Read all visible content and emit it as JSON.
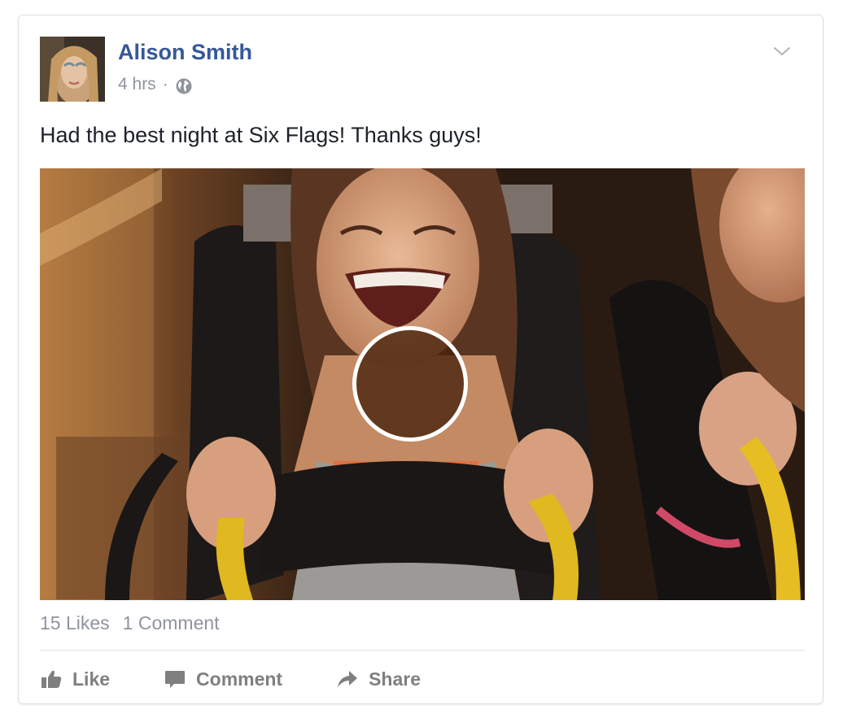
{
  "post": {
    "author": "Alison Smith",
    "timestamp": "4 hrs",
    "separator": "·",
    "audience_icon": "globe-icon",
    "menu_icon": "chevron-down-icon",
    "text": "Had the best night at Six Flags! Thanks guys!",
    "media": {
      "type": "video",
      "overlay_icon": "play-circle-icon"
    }
  },
  "stats": {
    "likes": "15 Likes",
    "comments": "1 Comment"
  },
  "actions": {
    "like_label": "Like",
    "like_icon": "thumbs-up-icon",
    "comment_label": "Comment",
    "comment_icon": "speech-bubble-icon",
    "share_label": "Share",
    "share_icon": "share-arrow-icon"
  },
  "colors": {
    "author_link": "#365899",
    "meta_text": "#90949c",
    "body_text": "#1d2129",
    "action_text": "#7f7f7f",
    "divider": "#dddfe2"
  }
}
